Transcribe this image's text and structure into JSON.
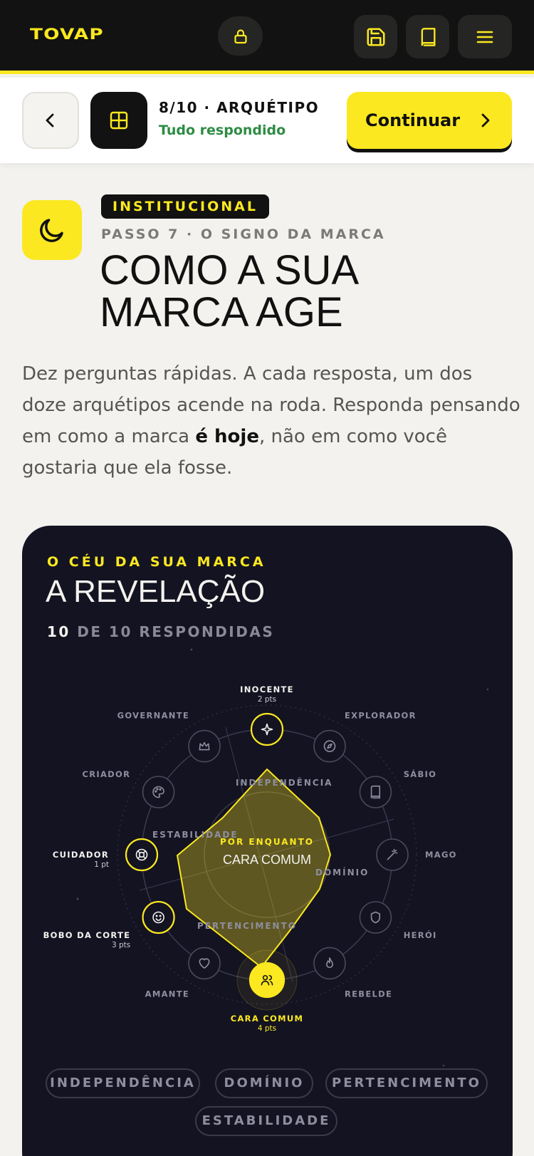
{
  "topbar": {
    "logo": "TOVAP",
    "lock_icon": "lock-icon",
    "save_icon": "floppy-disk-icon",
    "book_icon": "book-icon",
    "menu_icon": "hamburger-menu-icon"
  },
  "progress": {
    "step": "8/10 · ARQUÉTIPO",
    "status": "Tudo respondido",
    "continue_label": "Continuar"
  },
  "header": {
    "badge": "INSTITUCIONAL",
    "kicker": "PASSO 7 · O SIGNO DA MARCA",
    "title_line1": "COMO A SUA",
    "title_line2": "MARCA AGE",
    "intro_before": "Dez perguntas rápidas. A cada resposta, um dos doze arquétipos acende na roda. Responda pensando em como a marca ",
    "intro_bold": "é hoje",
    "intro_after": ", não em como você gostaria que ela fosse."
  },
  "card": {
    "kicker": "O CÉU DA SUA MARCA",
    "title": "A REVELAÇÃO",
    "count_n": "10",
    "count_rest": " DE 10 RESPONDIDAS",
    "center_kicker": "POR ENQUANTO",
    "center_value": "CARA COMUM",
    "axes": [
      "INDEPENDÊNCIA",
      "DOMÍNIO",
      "PERTENCIMENTO",
      "ESTABILIDADE"
    ],
    "chips": [
      "INDEPENDÊNCIA",
      "DOMÍNIO",
      "PERTENCIMENTO",
      "ESTABILIDADE"
    ],
    "archetypes": [
      {
        "name": "INOCENTE",
        "pts": "2 pts",
        "active": true,
        "icon": "sparkle-icon"
      },
      {
        "name": "EXPLORADOR",
        "pts": "",
        "active": false,
        "icon": "compass-icon"
      },
      {
        "name": "SÁBIO",
        "pts": "",
        "active": false,
        "icon": "book-icon"
      },
      {
        "name": "MAGO",
        "pts": "",
        "active": false,
        "icon": "magic-wand-icon"
      },
      {
        "name": "HERÓI",
        "pts": "",
        "active": false,
        "icon": "shield-icon"
      },
      {
        "name": "REBELDE",
        "pts": "",
        "active": false,
        "icon": "flame-icon"
      },
      {
        "name": "CARA COMUM",
        "pts": "4 pts",
        "active": true,
        "top": true,
        "icon": "users-icon"
      },
      {
        "name": "AMANTE",
        "pts": "",
        "active": false,
        "icon": "heart-icon"
      },
      {
        "name": "BOBO DA CORTE",
        "pts": "3 pts",
        "active": true,
        "icon": "smile-icon"
      },
      {
        "name": "CUIDADOR",
        "pts": "1 pt",
        "active": true,
        "icon": "lifebuoy-icon"
      },
      {
        "name": "CRIADOR",
        "pts": "",
        "active": false,
        "icon": "palette-icon"
      },
      {
        "name": "GOVERNANTE",
        "pts": "",
        "active": false,
        "icon": "crown-icon"
      }
    ]
  },
  "colors": {
    "accent": "#fbe820",
    "dark": "#121212",
    "card_bg": "#141322",
    "success": "#2d8c43"
  }
}
